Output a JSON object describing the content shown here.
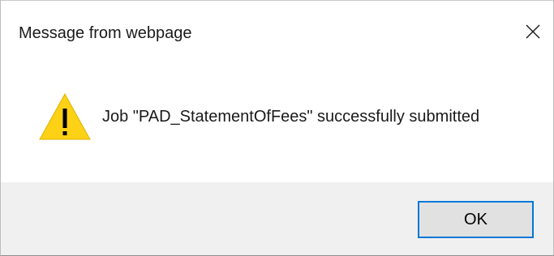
{
  "dialog": {
    "title": "Message from webpage",
    "message": "Job \"PAD_StatementOfFees\" successfully submitted",
    "icon": "warning-icon",
    "buttons": {
      "ok_label": "OK"
    }
  },
  "colors": {
    "accent": "#0078d7",
    "warning_fill": "#fcd116",
    "footer_bg": "#f0f0f0",
    "button_bg": "#e1e1e1"
  }
}
